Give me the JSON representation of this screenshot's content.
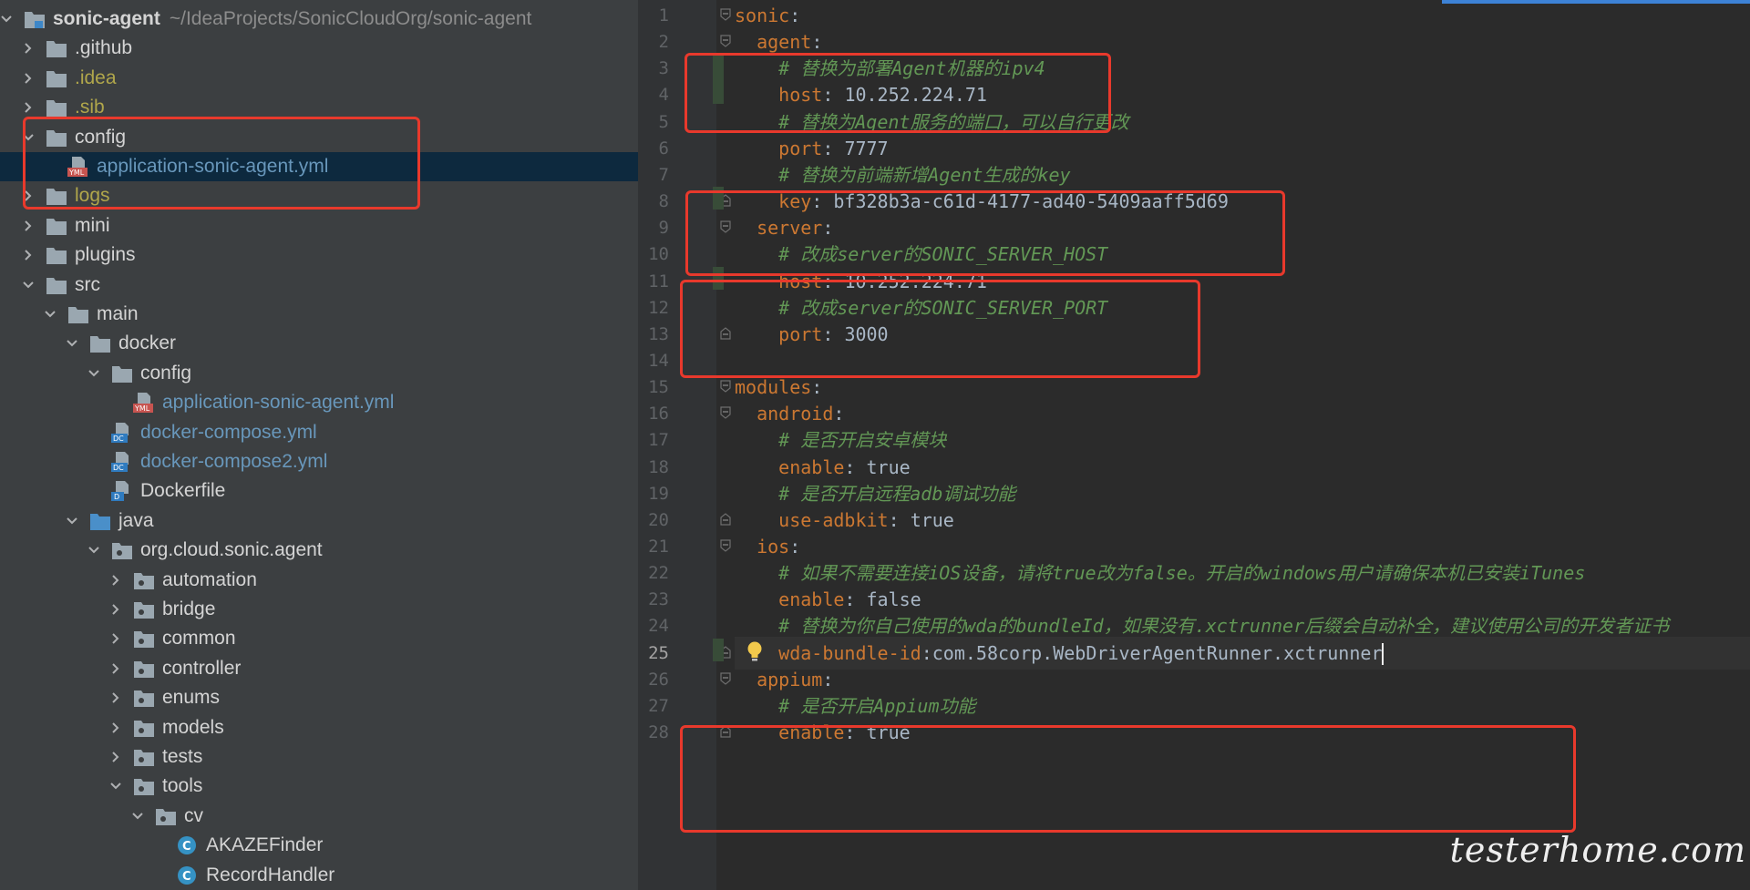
{
  "project": {
    "name": "sonic-agent",
    "path": "~/IdeaProjects/SonicCloudOrg/sonic-agent"
  },
  "tree": [
    {
      "label": "sonic-agent",
      "depth": 0,
      "chevron": "down",
      "icon": "module-folder-icon",
      "color": "bold"
    },
    {
      "label": ".github",
      "depth": 1,
      "chevron": "right",
      "icon": "folder-icon",
      "color": ""
    },
    {
      "label": ".idea",
      "depth": 1,
      "chevron": "right",
      "icon": "folder-icon",
      "color": "yellow"
    },
    {
      "label": ".sib",
      "depth": 1,
      "chevron": "right",
      "icon": "folder-icon",
      "color": "yellow"
    },
    {
      "label": "config",
      "depth": 1,
      "chevron": "down",
      "icon": "folder-icon",
      "color": ""
    },
    {
      "label": "application-sonic-agent.yml",
      "depth": 2,
      "chevron": "none",
      "icon": "yml-file-icon",
      "color": "blue",
      "selected": true
    },
    {
      "label": "logs",
      "depth": 1,
      "chevron": "right",
      "icon": "folder-icon",
      "color": "yellow"
    },
    {
      "label": "mini",
      "depth": 1,
      "chevron": "right",
      "icon": "folder-icon",
      "color": ""
    },
    {
      "label": "plugins",
      "depth": 1,
      "chevron": "right",
      "icon": "folder-icon",
      "color": ""
    },
    {
      "label": "src",
      "depth": 1,
      "chevron": "down",
      "icon": "folder-icon",
      "color": ""
    },
    {
      "label": "main",
      "depth": 2,
      "chevron": "down",
      "icon": "folder-icon",
      "color": ""
    },
    {
      "label": "docker",
      "depth": 3,
      "chevron": "down",
      "icon": "folder-icon",
      "color": ""
    },
    {
      "label": "config",
      "depth": 4,
      "chevron": "down",
      "icon": "folder-icon",
      "color": ""
    },
    {
      "label": "application-sonic-agent.yml",
      "depth": 5,
      "chevron": "none",
      "icon": "yml-file-icon",
      "color": "blue"
    },
    {
      "label": "docker-compose.yml",
      "depth": 4,
      "chevron": "none",
      "icon": "docker-compose-file-icon",
      "color": "blue"
    },
    {
      "label": "docker-compose2.yml",
      "depth": 4,
      "chevron": "none",
      "icon": "docker-compose-file-icon",
      "color": "blue"
    },
    {
      "label": "Dockerfile",
      "depth": 4,
      "chevron": "none",
      "icon": "dockerfile-icon",
      "color": ""
    },
    {
      "label": "java",
      "depth": 3,
      "chevron": "down",
      "icon": "source-folder-icon",
      "color": ""
    },
    {
      "label": "org.cloud.sonic.agent",
      "depth": 4,
      "chevron": "down",
      "icon": "package-icon",
      "color": ""
    },
    {
      "label": "automation",
      "depth": 5,
      "chevron": "right",
      "icon": "package-icon",
      "color": ""
    },
    {
      "label": "bridge",
      "depth": 5,
      "chevron": "right",
      "icon": "package-icon",
      "color": ""
    },
    {
      "label": "common",
      "depth": 5,
      "chevron": "right",
      "icon": "package-icon",
      "color": ""
    },
    {
      "label": "controller",
      "depth": 5,
      "chevron": "right",
      "icon": "package-icon",
      "color": ""
    },
    {
      "label": "enums",
      "depth": 5,
      "chevron": "right",
      "icon": "package-icon",
      "color": ""
    },
    {
      "label": "models",
      "depth": 5,
      "chevron": "right",
      "icon": "package-icon",
      "color": ""
    },
    {
      "label": "tests",
      "depth": 5,
      "chevron": "right",
      "icon": "package-icon",
      "color": ""
    },
    {
      "label": "tools",
      "depth": 5,
      "chevron": "down",
      "icon": "package-icon",
      "color": ""
    },
    {
      "label": "cv",
      "depth": 6,
      "chevron": "down",
      "icon": "package-icon",
      "color": ""
    },
    {
      "label": "AKAZEFinder",
      "depth": 7,
      "chevron": "none",
      "icon": "class-icon",
      "color": ""
    },
    {
      "label": "RecordHandler",
      "depth": 7,
      "chevron": "none",
      "icon": "class-icon",
      "color": ""
    }
  ],
  "editor": {
    "current_line": 25,
    "lines": [
      {
        "n": "1",
        "indent": "",
        "key": "sonic",
        "sep": ":",
        "val": "",
        "comment": ""
      },
      {
        "n": "2",
        "indent": "  ",
        "key": "agent",
        "sep": ":",
        "val": "",
        "comment": ""
      },
      {
        "n": "3",
        "indent": "    ",
        "key": "",
        "sep": "",
        "val": "",
        "comment": "# 替换为部署Agent机器的ipv4"
      },
      {
        "n": "4",
        "indent": "    ",
        "key": "host",
        "sep": ": ",
        "val": "10.252.224.71",
        "comment": ""
      },
      {
        "n": "5",
        "indent": "    ",
        "key": "",
        "sep": "",
        "val": "",
        "comment": "# 替换为Agent服务的端口，可以自行更改"
      },
      {
        "n": "6",
        "indent": "    ",
        "key": "port",
        "sep": ": ",
        "val": "7777",
        "comment": ""
      },
      {
        "n": "7",
        "indent": "    ",
        "key": "",
        "sep": "",
        "val": "",
        "comment": "# 替换为前端新增Agent生成的key"
      },
      {
        "n": "8",
        "indent": "    ",
        "key": "key",
        "sep": ": ",
        "val": "bf328b3a-c61d-4177-ad40-5409aaff5d69",
        "comment": ""
      },
      {
        "n": "9",
        "indent": "  ",
        "key": "server",
        "sep": ":",
        "val": "",
        "comment": ""
      },
      {
        "n": "10",
        "indent": "    ",
        "key": "",
        "sep": "",
        "val": "",
        "comment": "# 改成server的SONIC_SERVER_HOST"
      },
      {
        "n": "11",
        "indent": "    ",
        "key": "host",
        "sep": ": ",
        "val": "10.252.224.71",
        "comment": ""
      },
      {
        "n": "12",
        "indent": "    ",
        "key": "",
        "sep": "",
        "val": "",
        "comment": "# 改成server的SONIC_SERVER_PORT"
      },
      {
        "n": "13",
        "indent": "    ",
        "key": "port",
        "sep": ": ",
        "val": "3000",
        "comment": ""
      },
      {
        "n": "14",
        "indent": "",
        "key": "",
        "sep": "",
        "val": "",
        "comment": ""
      },
      {
        "n": "15",
        "indent": "",
        "key": "modules",
        "sep": ":",
        "val": "",
        "comment": ""
      },
      {
        "n": "16",
        "indent": "  ",
        "key": "android",
        "sep": ":",
        "val": "",
        "comment": ""
      },
      {
        "n": "17",
        "indent": "    ",
        "key": "",
        "sep": "",
        "val": "",
        "comment": "# 是否开启安卓模块"
      },
      {
        "n": "18",
        "indent": "    ",
        "key": "enable",
        "sep": ": ",
        "val": "true",
        "comment": ""
      },
      {
        "n": "19",
        "indent": "    ",
        "key": "",
        "sep": "",
        "val": "",
        "comment": "# 是否开启远程adb调试功能"
      },
      {
        "n": "20",
        "indent": "    ",
        "key": "use-adbkit",
        "sep": ": ",
        "val": "true",
        "comment": ""
      },
      {
        "n": "21",
        "indent": "  ",
        "key": "ios",
        "sep": ":",
        "val": "",
        "comment": ""
      },
      {
        "n": "22",
        "indent": "    ",
        "key": "",
        "sep": "",
        "val": "",
        "comment": "# 如果不需要连接iOS设备，请将true改为false。开启的windows用户请确保本机已安装iTunes"
      },
      {
        "n": "23",
        "indent": "    ",
        "key": "enable",
        "sep": ": ",
        "val": "false",
        "comment": ""
      },
      {
        "n": "24",
        "indent": "    ",
        "key": "",
        "sep": "",
        "val": "",
        "comment": "# 替换为你自己使用的wda的bundleId，如果没有.xctrunner后缀会自动补全，建议使用公司的开发者证书"
      },
      {
        "n": "25",
        "indent": "    ",
        "key": "wda-bundle-id",
        "sep": ":",
        "val": "com.58corp.WebDriverAgentRunner.xctrunner",
        "comment": ""
      },
      {
        "n": "26",
        "indent": "  ",
        "key": "appium",
        "sep": ":",
        "val": "",
        "comment": ""
      },
      {
        "n": "27",
        "indent": "    ",
        "key": "",
        "sep": "",
        "val": "",
        "comment": "# 是否开启Appium功能"
      },
      {
        "n": "28",
        "indent": "    ",
        "key": "enable",
        "sep": ": ",
        "val": "true",
        "comment": ""
      }
    ]
  },
  "watermark": "testerhome.com",
  "colors": {
    "highlight_box": "#e8392c",
    "key": "#cc7832",
    "comment": "#629755",
    "value": "#a9b7c6",
    "selection": "#0d293e"
  }
}
